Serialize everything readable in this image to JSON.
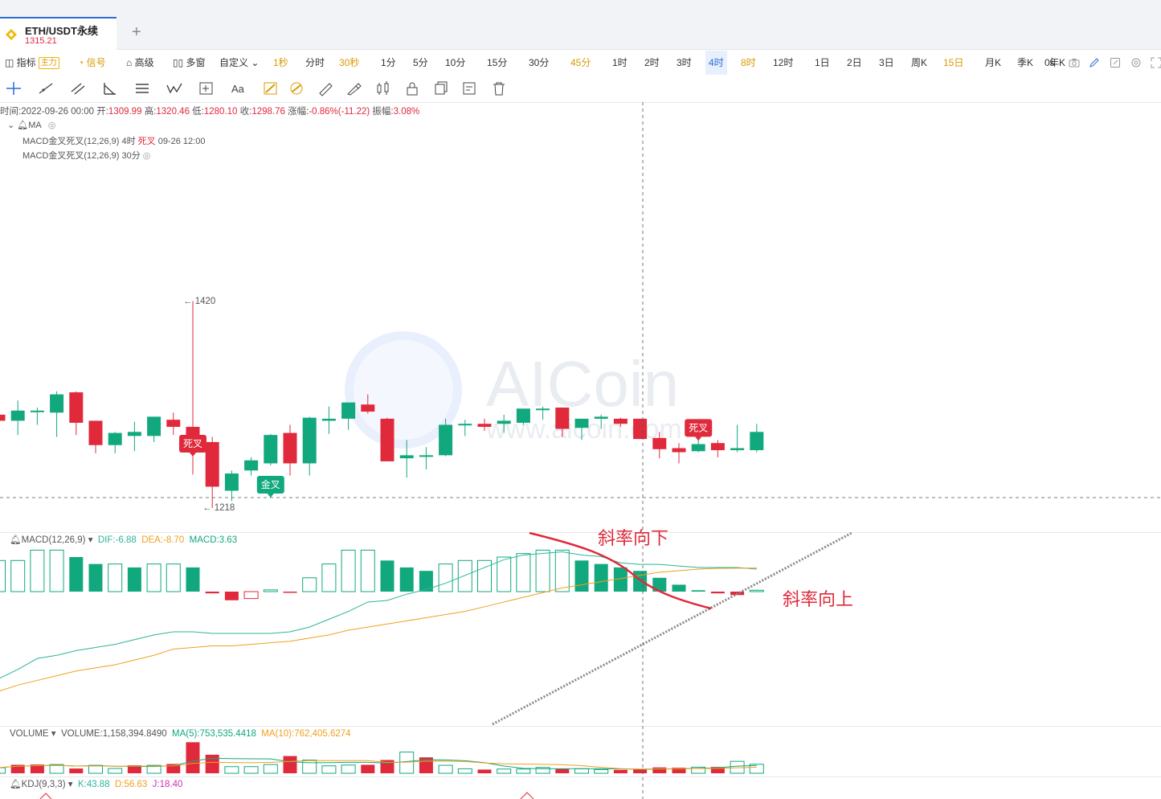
{
  "tab": {
    "symbol": "ETH/USDT永续",
    "price": "1315.21",
    "add": "+"
  },
  "toolbar": {
    "indicator": "指标",
    "main_badge": "主力",
    "signal": "信号",
    "advanced": "高级",
    "multi": "多窗",
    "custom": "自定义",
    "intervals": [
      "1秒",
      "分时",
      "30秒",
      "1分",
      "5分",
      "10分",
      "15分",
      "30分",
      "45分",
      "1时",
      "2时",
      "3时",
      "4时",
      "8时",
      "12时",
      "1日",
      "2日",
      "3日",
      "周K",
      "15日",
      "月K",
      "季K",
      "年K"
    ],
    "selected_interval": "4时",
    "countdown": "0s"
  },
  "info": {
    "time": "时间:2022-09-26 00:00",
    "open_label": "开:",
    "open": "1309.99",
    "high_label": "高:",
    "high": "1320.46",
    "low_label": "低:",
    "low": "1280.10",
    "close_label": "收:",
    "close": "1298.76",
    "change_label": "涨幅:",
    "change": "-0.86%(-11.22)",
    "amp_label": "振幅:",
    "amp": "3.08%"
  },
  "ma_label": "MA",
  "indicators": {
    "line1_prefix": "MACD金叉死叉(12,26,9) 4时",
    "line1_sig": "死叉",
    "line1_time": "09-26 12:00",
    "line2": "MACD金叉死叉(12,26,9) 30分"
  },
  "macd_panel": {
    "name": "MACD(12,26,9)",
    "dif": "DIF:-6.88",
    "dea": "DEA:-8.70",
    "macd": "MACD:3.63"
  },
  "volume_panel": {
    "name": "VOLUME",
    "volume": "VOLUME:1,158,394.8490",
    "ma5": "MA(5):753,535.4418",
    "ma10": "MA(10):762,405.6274"
  },
  "kdj_panel": {
    "name": "KDJ(9,3,3)",
    "k": "K:43.88",
    "d": "D:56.63",
    "j": "J:18.40"
  },
  "annotations": {
    "down": "斜率向下",
    "up": "斜率向上"
  },
  "watermark": {
    "brand": "AICoin",
    "site": "www.aicoin.com"
  },
  "colors": {
    "up": "#12a87e",
    "down": "#e0293b",
    "dif": "#2bb59a",
    "dea": "#f0a020",
    "accent": "#2e6bd6"
  },
  "chart_data": [
    {
      "type": "candlestick",
      "title": "ETH/USDT永续 4时",
      "max_label": "1420",
      "min_label": "1218",
      "signals": [
        {
          "label": "死叉",
          "index": 10
        },
        {
          "label": "金叉",
          "index": 14
        },
        {
          "label": "死叉",
          "index": 36
        }
      ],
      "ohlc": [
        [
          1310,
          1320,
          1296,
          1304
        ],
        [
          1304,
          1324,
          1290,
          1314
        ],
        [
          1314,
          1317,
          1300,
          1314
        ],
        [
          1312,
          1333,
          1288,
          1330
        ],
        [
          1332,
          1333,
          1290,
          1302
        ],
        [
          1304,
          1304,
          1272,
          1280
        ],
        [
          1280,
          1293,
          1272,
          1292
        ],
        [
          1289,
          1303,
          1274,
          1293
        ],
        [
          1289,
          1308,
          1283,
          1308
        ],
        [
          1305,
          1312,
          1290,
          1298
        ],
        [
          1298,
          1422,
          1251,
          1282
        ],
        [
          1283,
          1288,
          1218,
          1239
        ],
        [
          1235,
          1255,
          1225,
          1252
        ],
        [
          1255,
          1268,
          1250,
          1265
        ],
        [
          1262,
          1291,
          1260,
          1290
        ],
        [
          1292,
          1300,
          1250,
          1262
        ],
        [
          1262,
          1308,
          1250,
          1307
        ],
        [
          1304,
          1318,
          1291,
          1306
        ],
        [
          1306,
          1317,
          1295,
          1322
        ],
        [
          1320,
          1330,
          1311,
          1313
        ],
        [
          1306,
          1307,
          1264,
          1264
        ],
        [
          1267,
          1285,
          1248,
          1270
        ],
        [
          1270,
          1278,
          1256,
          1270
        ],
        [
          1270,
          1306,
          1269,
          1300
        ],
        [
          1301,
          1305,
          1289,
          1301
        ],
        [
          1301,
          1306,
          1294,
          1298
        ],
        [
          1301,
          1310,
          1292,
          1304
        ],
        [
          1302,
          1314,
          1300,
          1316
        ],
        [
          1315,
          1318,
          1305,
          1316
        ],
        [
          1317,
          1317,
          1288,
          1296
        ],
        [
          1297,
          1305,
          1285,
          1306
        ],
        [
          1306,
          1310,
          1296,
          1308
        ],
        [
          1306,
          1307,
          1298,
          1301
        ],
        [
          1306,
          1306,
          1286,
          1286
        ],
        [
          1287,
          1293,
          1267,
          1276
        ],
        [
          1277,
          1282,
          1262,
          1273
        ],
        [
          1274,
          1285,
          1273,
          1281
        ],
        [
          1282,
          1285,
          1268,
          1275
        ],
        [
          1275,
          1300,
          1273,
          1277
        ],
        [
          1275,
          1301,
          1273,
          1293
        ]
      ]
    },
    {
      "type": "bar",
      "title": "MACD(12,26,9)",
      "histogram": [
        9,
        9,
        12,
        12,
        10,
        8,
        8,
        7,
        8,
        8,
        7,
        -0.5,
        -2.5,
        -2,
        0.5,
        -0.3,
        4,
        8,
        12,
        12,
        9,
        7,
        6,
        8,
        9,
        9,
        10,
        11,
        12,
        12,
        9,
        8,
        7,
        6,
        4,
        2,
        0.4,
        -0.5,
        -1,
        0.4
      ],
      "dif": [
        -70,
        -64,
        -57,
        -55,
        -52,
        -50,
        -48,
        -45,
        -42,
        -40,
        -40,
        -41,
        -41,
        -41,
        -41,
        -40,
        -37,
        -32,
        -27,
        -21,
        -20,
        -16,
        -13,
        -9,
        -4,
        1,
        6,
        9,
        10,
        11,
        9,
        8,
        4,
        3,
        3,
        2,
        1,
        1,
        1,
        0
      ],
      "dea": [
        -78,
        -74,
        -71,
        -68,
        -65,
        -63,
        -61,
        -58,
        -55,
        -51,
        -50,
        -49,
        -49,
        -48,
        -47,
        -46,
        -44,
        -42,
        -39,
        -37,
        -35,
        -33,
        -31,
        -29,
        -27,
        -24,
        -21,
        -18,
        -15,
        -12,
        -10,
        -8,
        -6,
        -4,
        -2,
        -1,
        0,
        0.5,
        0.6,
        0.7
      ]
    },
    {
      "type": "bar",
      "title": "VOLUME",
      "volume": [
        2.1,
        3.2,
        3.3,
        3.3,
        1.8,
        3.0,
        1.8,
        3.0,
        3.0,
        3.5,
        11.7,
        7.0,
        2.5,
        2.5,
        3.3,
        6.5,
        5.0,
        2.8,
        3.1,
        3.2,
        5.0,
        8.0,
        6.0,
        3.0,
        1.7,
        1.4,
        1.6,
        1.6,
        2.2,
        1.7,
        1.7,
        1.4,
        1.3,
        1.4,
        2.2,
        2.1,
        2.3,
        2.4,
        4.5,
        3.4
      ],
      "vol_up": [
        true,
        false,
        false,
        true,
        false,
        true,
        true,
        false,
        true,
        false,
        false,
        false,
        true,
        true,
        true,
        false,
        true,
        true,
        true,
        false,
        false,
        true,
        false,
        true,
        true,
        false,
        true,
        true,
        true,
        false,
        true,
        true,
        false,
        false,
        false,
        false,
        true,
        false,
        true,
        true
      ]
    }
  ]
}
